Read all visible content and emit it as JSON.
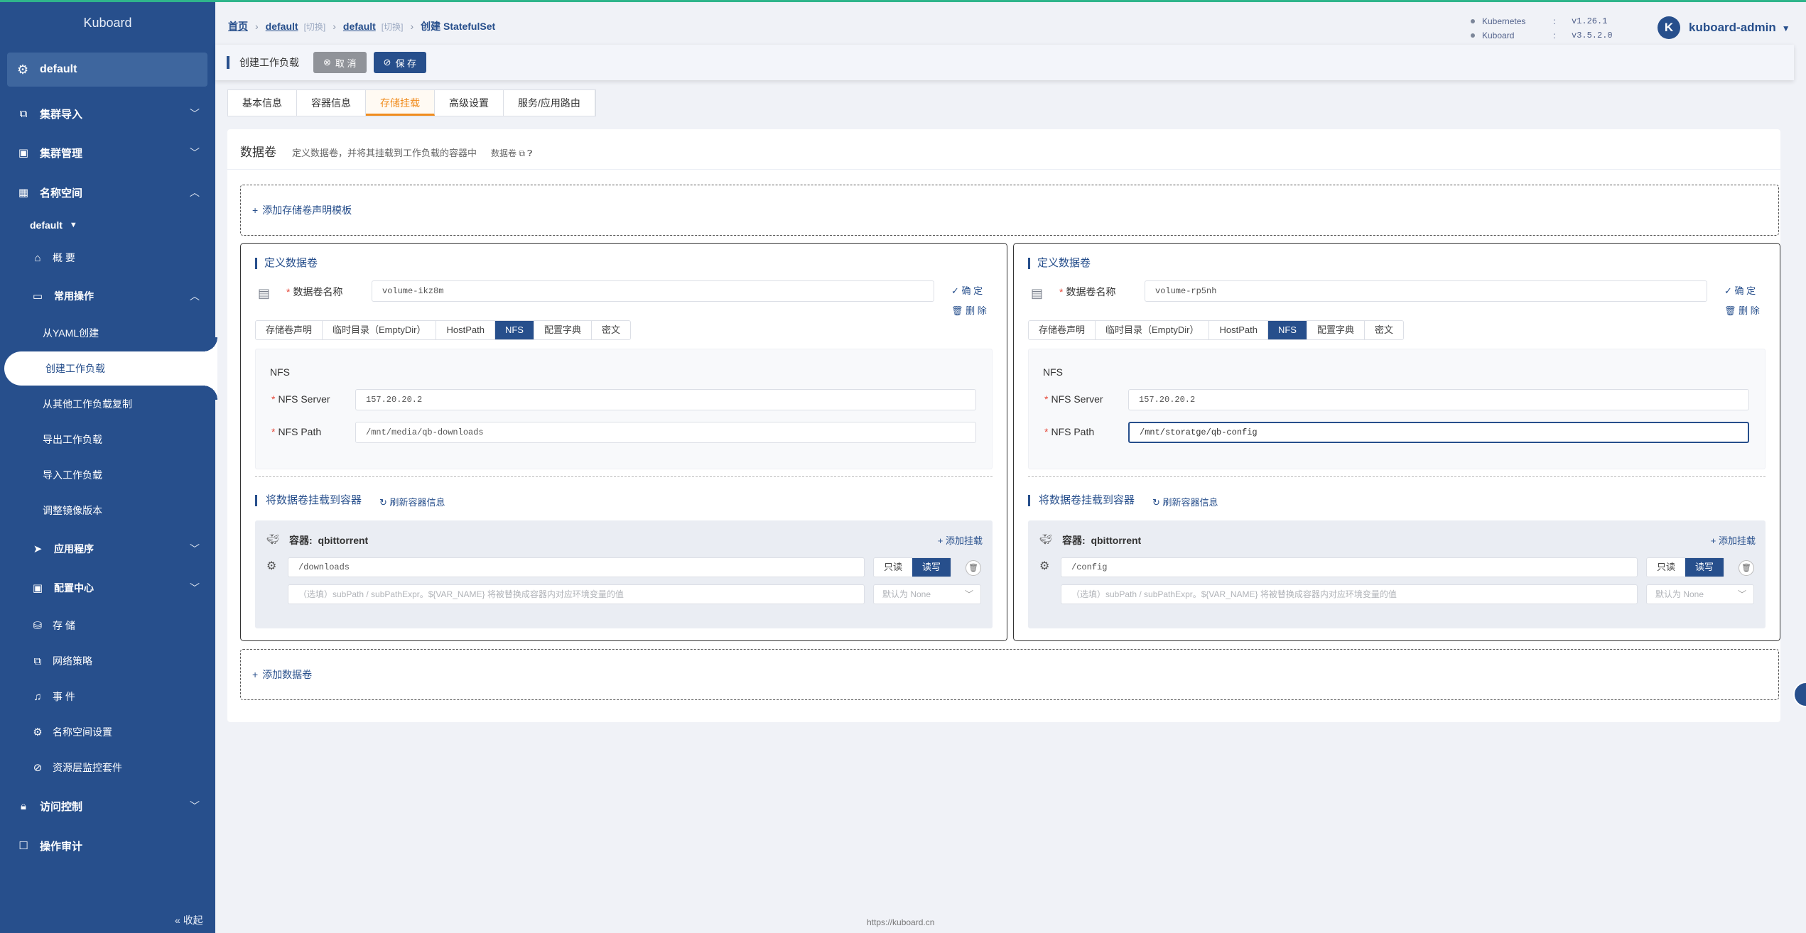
{
  "sidebar": {
    "logo": "Kuboard",
    "namespace": "default",
    "items": {
      "cluster_import": "集群导入",
      "cluster_manage": "集群管理",
      "namespace": "名称空间",
      "ns_select": "default",
      "overview": "概 要",
      "common_ops": "常用操作",
      "from_yaml": "从YAML创建",
      "create_workload": "创建工作负载",
      "copy_workload": "从其他工作负载复制",
      "export_workload": "导出工作负载",
      "import_workload": "导入工作负载",
      "adjust_image": "调整镜像版本",
      "apps": "应用程序",
      "config_center": "配置中心",
      "storage": "存 储",
      "net_policy": "网络策略",
      "events": "事 件",
      "ns_settings": "名称空间设置",
      "monitor": "资源层监控套件",
      "access_control": "访问控制",
      "audit": "操作审计"
    },
    "collapse": "收起"
  },
  "header": {
    "crumbs": {
      "home": "首页",
      "cluster": "default",
      "cluster_switch": "[切换]",
      "ns": "default",
      "ns_switch": "[切换]",
      "current": "创建 StatefulSet"
    },
    "versions": [
      {
        "name": "Kubernetes",
        "value": "v1.26.1"
      },
      {
        "name": "Kuboard",
        "value": "v3.5.2.0"
      }
    ],
    "avatar_letter": "K",
    "user": "kuboard-admin"
  },
  "toolbar": {
    "title": "创建工作负载",
    "cancel": "取 消",
    "save": "保 存"
  },
  "tabs": [
    "基本信息",
    "容器信息",
    "存储挂载",
    "高级设置",
    "服务/应用路由"
  ],
  "active_tab": "存储挂载",
  "volumes_section": {
    "title": "数据卷",
    "desc": "定义数据卷，并将其挂载到工作负载的容器中",
    "doc_link": "数据卷",
    "add_pvc_template": "添加存储卷声明模板",
    "add_volume": "添加数据卷"
  },
  "volume_labels": {
    "define": "定义数据卷",
    "name_label": "数据卷名称",
    "confirm": "确 定",
    "delete": "删 除",
    "type_tabs": [
      "存储卷声明",
      "临时目录（EmptyDir）",
      "HostPath",
      "NFS",
      "配置字典",
      "密文"
    ],
    "active_type": "NFS",
    "nfs_heading": "NFS",
    "nfs_server_label": "NFS Server",
    "nfs_path_label": "NFS Path",
    "mount_title": "将数据卷挂载到容器",
    "refresh": "刷新容器信息",
    "container_label": "容器:",
    "add_mount": "添加挂载",
    "readonly": "只读",
    "readwrite": "读写",
    "subpath_placeholder": "（选填）subPath / subPathExpr。${VAR_NAME} 将被替换成容器内对应环境变量的值",
    "propagation_placeholder": "默认为 None"
  },
  "volumes": [
    {
      "name": "volume-ikz8m",
      "nfs_server": "157.20.20.2",
      "nfs_path": "/mnt/media/qb-downloads",
      "container": "qbittorrent",
      "mount_path": "/downloads"
    },
    {
      "name": "volume-rp5nh",
      "nfs_server": "157.20.20.2",
      "nfs_path": "/mnt/storatge/qb-config",
      "container": "qbittorrent",
      "mount_path": "/config"
    }
  ],
  "footer": "https://kuboard.cn"
}
